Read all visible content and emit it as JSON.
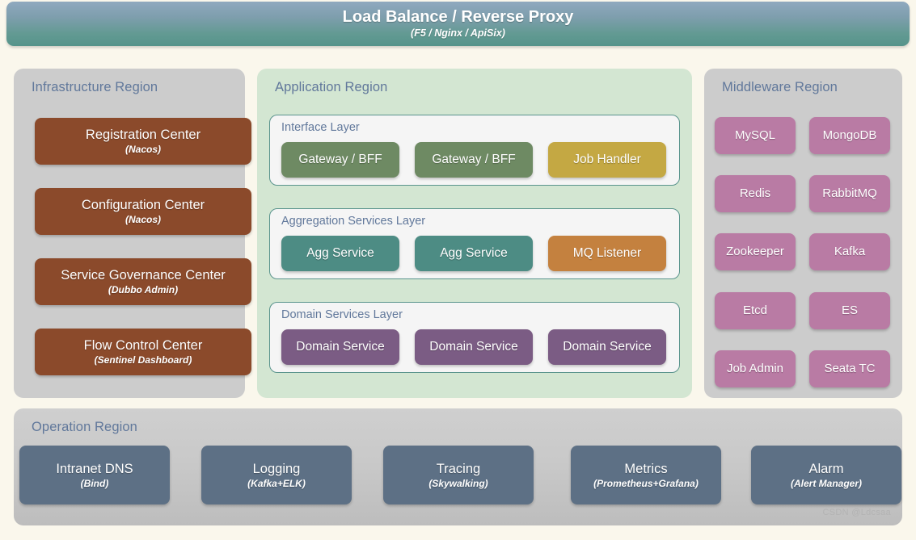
{
  "banner": {
    "title": "Load Balance / Reverse Proxy",
    "subtitle": "(F5 / Nginx / ApiSix)",
    "gradient_from": "#8FA9BF",
    "gradient_to": "#55948A"
  },
  "infrastructure_region": {
    "title": "Infrastructure Region",
    "background": "#CCCCCC",
    "node_color": "#8B4A2B",
    "nodes": [
      {
        "name": "Registration Center",
        "subtitle": "(Nacos)"
      },
      {
        "name": "Configuration Center",
        "subtitle": "(Nacos)"
      },
      {
        "name": "Service Governance Center",
        "subtitle": "(Dubbo Admin)"
      },
      {
        "name": "Flow Control Center",
        "subtitle": "(Sentinel Dashboard)"
      }
    ]
  },
  "application_region": {
    "title": "Application Region",
    "background": "#D3E6D2",
    "layers": [
      {
        "title": "Interface Layer",
        "nodes": [
          {
            "name": "Gateway / BFF",
            "color": "#6E8A63"
          },
          {
            "name": "Gateway / BFF",
            "color": "#6E8A63"
          },
          {
            "name": "Job Handler",
            "color": "#C4A843"
          }
        ]
      },
      {
        "title": "Aggregation Services Layer",
        "nodes": [
          {
            "name": "Agg Service",
            "color": "#4D8C84"
          },
          {
            "name": "Agg Service",
            "color": "#4D8C84"
          },
          {
            "name": "MQ Listener",
            "color": "#C4813F"
          }
        ]
      },
      {
        "title": "Domain Services Layer",
        "nodes": [
          {
            "name": "Domain Service",
            "color": "#7B5C84"
          },
          {
            "name": "Domain Service",
            "color": "#7B5C84"
          },
          {
            "name": "Domain Service",
            "color": "#7B5C84"
          }
        ]
      }
    ]
  },
  "middleware_region": {
    "title": "Middleware Region",
    "background": "#CCCCCC",
    "node_color": "#B97BA4",
    "nodes": [
      {
        "name": "MySQL"
      },
      {
        "name": "MongoDB"
      },
      {
        "name": "Redis"
      },
      {
        "name": "RabbitMQ"
      },
      {
        "name": "Zookeeper"
      },
      {
        "name": "Kafka"
      },
      {
        "name": "Etcd"
      },
      {
        "name": "ES"
      },
      {
        "name": "Job Admin"
      },
      {
        "name": "Seata TC"
      }
    ]
  },
  "operation_region": {
    "title": "Operation Region",
    "background": "#C9C9C9",
    "node_color": "#5D7085",
    "nodes": [
      {
        "name": "Intranet DNS",
        "subtitle": "(Bind)"
      },
      {
        "name": "Logging",
        "subtitle": "(Kafka+ELK)"
      },
      {
        "name": "Tracing",
        "subtitle": "(Skywalking)"
      },
      {
        "name": "Metrics",
        "subtitle": "(Prometheus+Grafana)"
      },
      {
        "name": "Alarm",
        "subtitle": "(Alert Manager)"
      }
    ]
  },
  "watermark": "CSDN @Ldcsaa",
  "page": {
    "background": "#FAF7EC",
    "region_title_color": "#61789B"
  }
}
